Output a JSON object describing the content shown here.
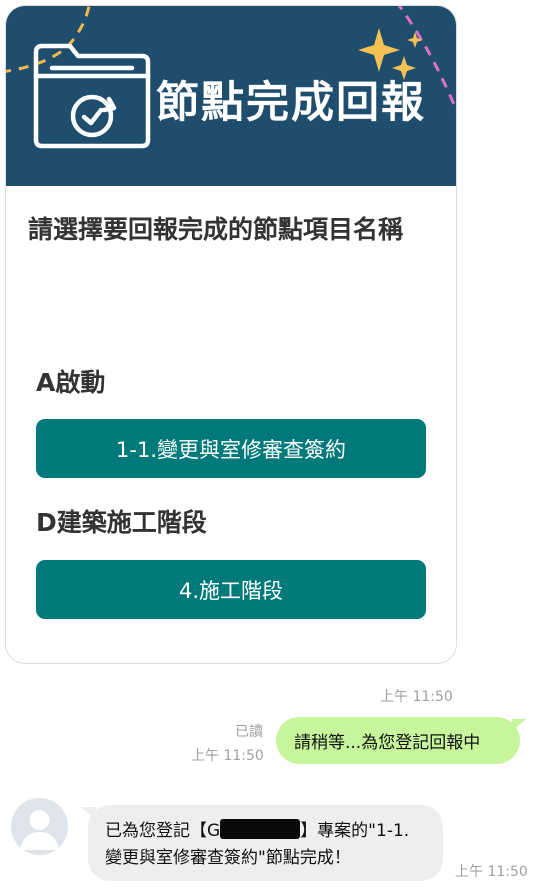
{
  "card": {
    "header_title": "節點完成回報",
    "prompt": "請選擇要回報完成的節點項目名稱",
    "sections": [
      {
        "title": "A啟動",
        "button_label": "1-1.變更與室修審查簽約"
      },
      {
        "title": "D建築施工階段",
        "button_label": "4.施工階段"
      }
    ],
    "header_bg": "#1f4d6e",
    "button_color": "#00797a",
    "icon": "folder-refresh-icon"
  },
  "messages": {
    "card_time": "上午 11:50",
    "sent": {
      "read_label": "已讀",
      "time": "上午 11:50",
      "text": "請稍等...為您登記回報中"
    },
    "received": {
      "text_before": "已為您登記【G",
      "text_after": "】專案的\"1-1.變更與室修審查簽約\"節點完成！",
      "time": "上午 11:50"
    }
  }
}
